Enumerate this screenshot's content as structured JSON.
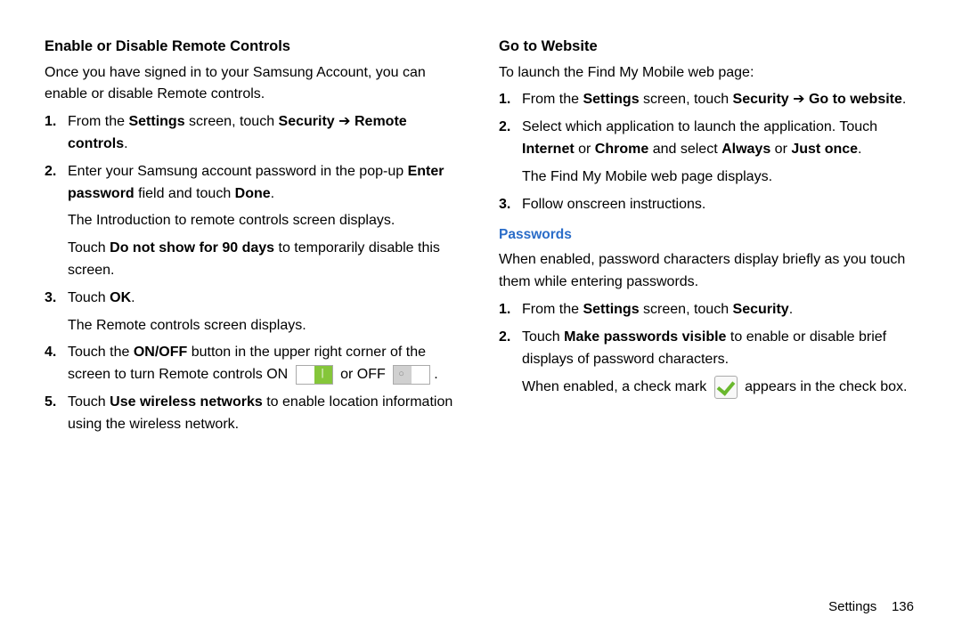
{
  "left": {
    "h4": "Enable or Disable Remote Controls",
    "intro": "Once you have signed in to your Samsung Account, you can enable or disable Remote controls.",
    "step1_a": "From the ",
    "step1_b": "Settings",
    "step1_c": " screen, touch ",
    "step1_d": "Security",
    "step1_arrow": " ➔ ",
    "step1_e": "Remote controls",
    "step1_f": ".",
    "step2_a": "Enter your Samsung account password in the pop-up ",
    "step2_b": "Enter password",
    "step2_c": " field and touch ",
    "step2_d": "Done",
    "step2_e": ".",
    "step2_sub1": "The Introduction to remote controls screen displays.",
    "step2_sub2a": "Touch ",
    "step2_sub2b": "Do not show for 90 days",
    "step2_sub2c": " to temporarily disable this screen.",
    "step3_a": "Touch ",
    "step3_b": "OK",
    "step3_c": ".",
    "step3_sub": "The Remote controls screen displays.",
    "step4_a": "Touch the ",
    "step4_b": "ON/OFF",
    "step4_c": " button in the upper right corner of the screen to turn Remote controls ON ",
    "step4_d": " or OFF ",
    "step4_e": ".",
    "step5_a": "Touch ",
    "step5_b": "Use wireless networks",
    "step5_c": " to enable location information using the wireless network."
  },
  "right": {
    "h4": "Go to Website",
    "intro": "To launch the Find My Mobile web page:",
    "step1_a": "From the ",
    "step1_b": "Settings",
    "step1_c": " screen, touch ",
    "step1_d": "Security",
    "step1_arrow": " ➔ ",
    "step1_e": "Go to website",
    "step1_f": ".",
    "step2_a": "Select which application to launch the application. Touch ",
    "step2_b": "Internet",
    "step2_c": " or ",
    "step2_d": "Chrome",
    "step2_e": " and select ",
    "step2_f": "Always",
    "step2_g": " or ",
    "step2_h": "Just once",
    "step2_i": ".",
    "step2_sub": "The Find My Mobile web page displays.",
    "step3": "Follow onscreen instructions.",
    "section": "Passwords",
    "pw_intro": "When enabled, password characters display briefly as you touch them while entering passwords.",
    "pw1_a": "From the ",
    "pw1_b": "Settings",
    "pw1_c": " screen, touch ",
    "pw1_d": "Security",
    "pw1_e": ".",
    "pw2_a": "Touch ",
    "pw2_b": "Make passwords visible",
    "pw2_c": " to enable or disable brief displays of password characters.",
    "pw2_sub_a": "When enabled, a check mark ",
    "pw2_sub_b": " appears in the check box."
  },
  "footer": {
    "label": "Settings",
    "page": "136"
  }
}
